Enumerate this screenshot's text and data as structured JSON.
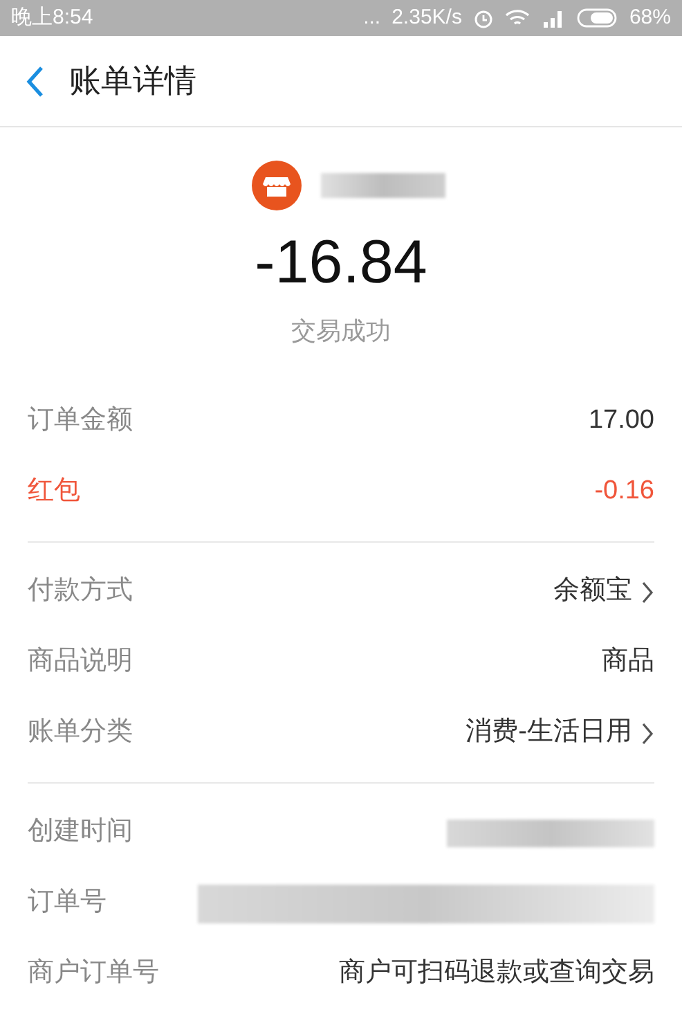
{
  "status_bar": {
    "time": "晚上8:54",
    "dots": "...",
    "speed": "2.35K/s",
    "battery": "68%"
  },
  "header": {
    "title": "账单详情"
  },
  "summary": {
    "amount": "-16.84",
    "status": "交易成功"
  },
  "sections": [
    {
      "rows": [
        {
          "label": "订单金额",
          "value": "17.00",
          "kind": "plain"
        },
        {
          "label": "红包",
          "value": "-0.16",
          "kind": "discount"
        }
      ]
    },
    {
      "rows": [
        {
          "label": "付款方式",
          "value": "余额宝",
          "kind": "link"
        },
        {
          "label": "商品说明",
          "value": "商品",
          "kind": "plain"
        },
        {
          "label": "账单分类",
          "value": "消费-生活日用",
          "kind": "link"
        }
      ]
    },
    {
      "rows": [
        {
          "label": "创建时间",
          "kind": "redacted"
        },
        {
          "label": "订单号",
          "kind": "redacted_wide"
        },
        {
          "label": "商户订单号",
          "value": "商户可扫码退款或查询交易",
          "kind": "plain"
        }
      ]
    }
  ]
}
